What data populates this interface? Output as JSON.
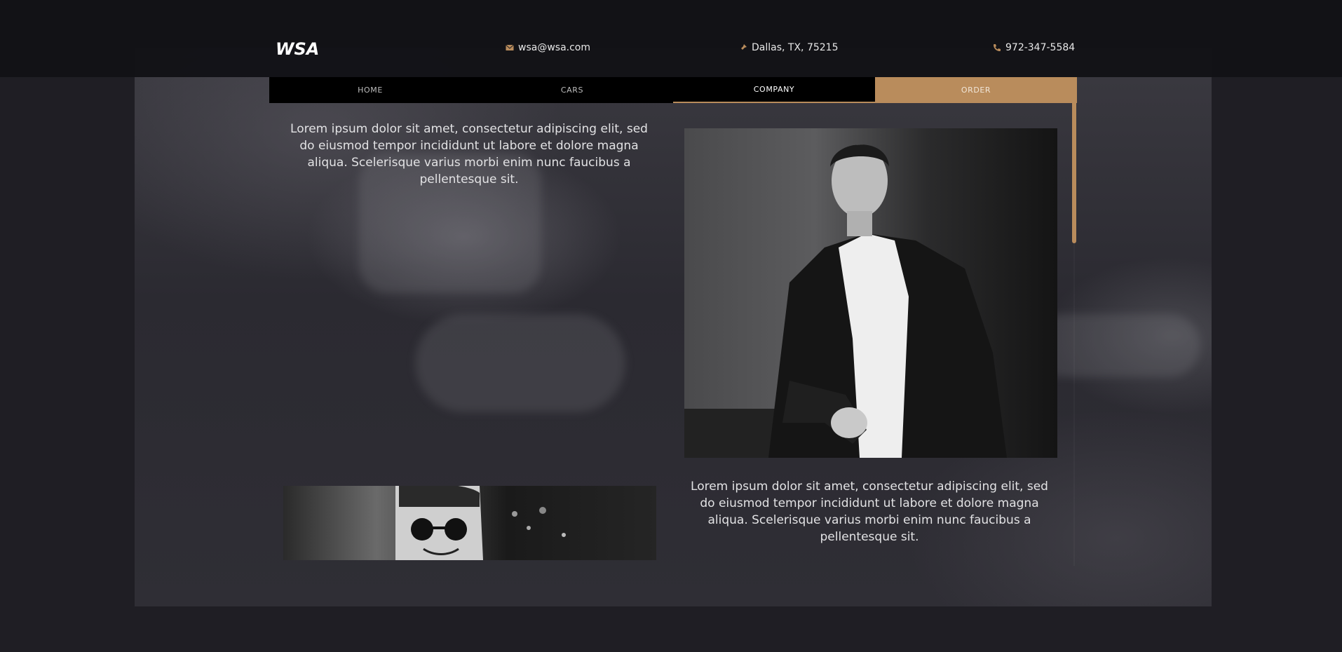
{
  "header": {
    "logo_text": "WSA",
    "email": "wsa@wsa.com",
    "location": "Dallas, TX, 75215",
    "phone": "972-347-5584",
    "icons": {
      "email": "envelope-icon",
      "location": "pin-icon",
      "phone": "phone-icon"
    }
  },
  "nav": {
    "items": [
      {
        "label": "HOME"
      },
      {
        "label": "CARS"
      },
      {
        "label": "COMPANY"
      },
      {
        "label": "ORDER"
      }
    ],
    "active": "COMPANY"
  },
  "content": {
    "paragraph_1": "Lorem ipsum dolor sit amet, consectetur adipiscing elit, sed do eiusmod tempor incididunt ut labore et dolore magna aliqua. Scelerisque varius morbi enim nunc faucibus a pellentesque sit.",
    "paragraph_2": "Lorem ipsum dolor sit amet, consectetur adipiscing elit, sed do eiusmod tempor incididunt ut labore et dolore magna aliqua. Scelerisque varius morbi enim nunc faucibus a pellentesque sit."
  },
  "colors": {
    "accent": "#b98c5c",
    "background": "#1f1e24",
    "nav": "#000000"
  }
}
